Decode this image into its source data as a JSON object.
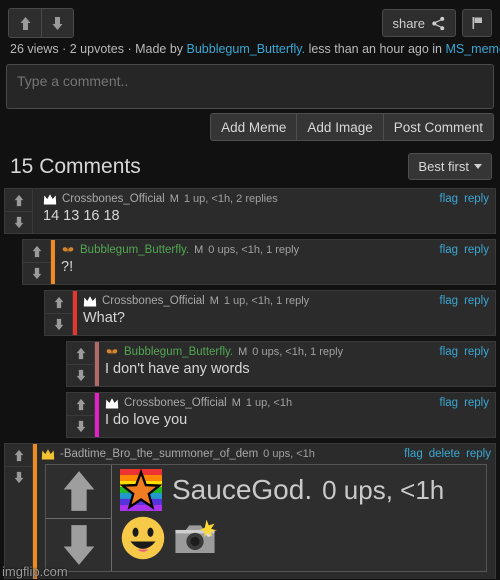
{
  "topbar": {
    "upvote_icon": "arrow-up-icon",
    "downvote_icon": "arrow-down-icon",
    "share_label": "share",
    "share_icon": "share-nodes-icon",
    "flag_icon": "flag-icon"
  },
  "meta": {
    "views": "26 views",
    "sep1": " · ",
    "upvotes": "2 upvotes",
    "sep2": " · ",
    "made_by": "Made by ",
    "author": "Bubblegum_Butterfly.",
    "time": " less than an hour ago in ",
    "stream": "MS_memer_group"
  },
  "composer": {
    "placeholder": "Type a comment..",
    "value": "",
    "add_meme": "Add Meme",
    "add_image": "Add Image",
    "post_comment": "Post Comment"
  },
  "comments_header": {
    "title": "15 Comments",
    "sort_label": "Best first",
    "sort_caret": "chevron-down-icon"
  },
  "comments": [
    {
      "indent": 0,
      "bar_color": "transparent",
      "avatar": "white-crown-icon",
      "avatar_color": "#ffffff",
      "username": "Crossbones_Official",
      "username_color": "gray",
      "badge": "M",
      "stats": "1 up, <1h, 2 replies",
      "links": [
        "flag",
        "reply"
      ],
      "text": "14 13 16 18"
    },
    {
      "indent": 1,
      "bar_color": "#ef8b22",
      "avatar": "butterfly-icon",
      "avatar_color": "#d2842f",
      "username": "Bubblegum_Butterfly.",
      "username_color": "green",
      "badge": "M",
      "stats": "0 ups, <1h, 1 reply",
      "links": [
        "flag",
        "reply"
      ],
      "text": "?!"
    },
    {
      "indent": 2,
      "bar_color": "#e8352e",
      "avatar": "white-crown-icon",
      "avatar_color": "#ffffff",
      "username": "Crossbones_Official",
      "username_color": "gray",
      "badge": "M",
      "stats": "1 up, <1h, 1 reply",
      "links": [
        "flag",
        "reply"
      ],
      "text": "What?"
    },
    {
      "indent": 3,
      "bar_color": "#b06a66",
      "avatar": "butterfly-icon",
      "avatar_color": "#d2842f",
      "username": "Bubblegum_Butterfly.",
      "username_color": "green",
      "badge": "M",
      "stats": "0 ups, <1h, 1 reply",
      "links": [
        "flag",
        "reply"
      ],
      "text": "I don't have any words"
    },
    {
      "indent": 3,
      "bar_color": "#e61ec8",
      "avatar": "white-crown-icon",
      "avatar_color": "#ffffff",
      "username": "Crossbones_Official",
      "username_color": "gray",
      "badge": "M",
      "stats": "1 up, <1h",
      "links": [
        "flag",
        "reply"
      ],
      "text": "I do love you"
    }
  ],
  "last_comment": {
    "indent": 0,
    "bar_color": "#ef8b22",
    "avatar": "gold-crown-icon",
    "avatar_color": "#f2c230",
    "username": "-Badtime_Bro_the_summoner_of_dem",
    "badge": "",
    "stats": "0 ups, <1h",
    "links": [
      "flag",
      "delete",
      "reply"
    ]
  },
  "embedded_image": {
    "upvote_icon": "arrow-up-icon",
    "downvote_icon": "arrow-down-icon",
    "avatar": "rainbow-star-icon",
    "username": "SauceGod.",
    "stats": "0 ups, <1h",
    "emojis": [
      "grinning-face-emoji",
      "camera-with-flash-emoji"
    ]
  },
  "watermark": "imgflip.com",
  "colors": {
    "link": "#3aa7d4",
    "green_user": "#53a653",
    "page_bg": "#111111",
    "row_bg": "#2b2b2b"
  }
}
